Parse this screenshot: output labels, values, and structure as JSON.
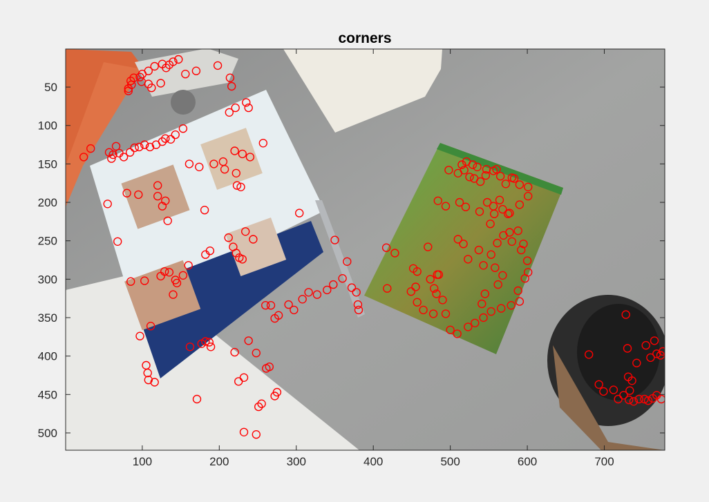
{
  "figure": {
    "background": "#f0f0f0"
  },
  "chart_data": {
    "type": "scatter",
    "title": "corners",
    "xlabel": "",
    "ylabel": "",
    "xlim": [
      0.5,
      778.5
    ],
    "ylim": [
      0.5,
      522.5
    ],
    "y_reversed": true,
    "xticks": [
      100,
      200,
      300,
      400,
      500,
      600,
      700
    ],
    "yticks": [
      50,
      100,
      150,
      200,
      250,
      300,
      350,
      400,
      450,
      500
    ],
    "grid": false,
    "legend": "none",
    "marker": "circle",
    "marker_color": "#ff0000",
    "background_image": "photo of a table with flyer, pen, DVD case, papers and coffee cup",
    "points": [
      [
        147,
        14
      ],
      [
        140,
        17
      ],
      [
        135,
        21
      ],
      [
        126,
        20
      ],
      [
        131,
        25
      ],
      [
        116,
        23
      ],
      [
        108,
        29
      ],
      [
        100,
        33
      ],
      [
        97,
        37
      ],
      [
        89,
        38
      ],
      [
        85,
        42
      ],
      [
        86,
        47
      ],
      [
        99,
        43
      ],
      [
        108,
        46
      ],
      [
        112,
        51
      ],
      [
        124,
        45
      ],
      [
        156,
        33
      ],
      [
        170,
        29
      ],
      [
        198,
        22
      ],
      [
        214,
        38
      ],
      [
        216,
        49
      ],
      [
        221,
        77
      ],
      [
        213,
        83
      ],
      [
        235,
        70
      ],
      [
        238,
        77
      ],
      [
        82,
        52
      ],
      [
        82,
        55
      ],
      [
        57,
        135
      ],
      [
        62,
        138
      ],
      [
        70,
        136
      ],
      [
        76,
        141
      ],
      [
        84,
        135
      ],
      [
        90,
        129
      ],
      [
        96,
        128
      ],
      [
        103,
        125
      ],
      [
        110,
        128
      ],
      [
        118,
        125
      ],
      [
        126,
        121
      ],
      [
        130,
        117
      ],
      [
        137,
        118
      ],
      [
        143,
        112
      ],
      [
        153,
        104
      ],
      [
        66,
        127
      ],
      [
        24,
        141
      ],
      [
        33,
        130
      ],
      [
        60,
        143
      ],
      [
        220,
        133
      ],
      [
        230,
        137
      ],
      [
        240,
        141
      ],
      [
        257,
        123
      ],
      [
        161,
        150
      ],
      [
        174,
        154
      ],
      [
        193,
        150
      ],
      [
        205,
        147
      ],
      [
        207,
        157
      ],
      [
        222,
        162
      ],
      [
        55,
        202
      ],
      [
        80,
        188
      ],
      [
        95,
        190
      ],
      [
        120,
        178
      ],
      [
        120,
        192
      ],
      [
        126,
        205
      ],
      [
        130,
        198
      ],
      [
        133,
        224
      ],
      [
        181,
        210
      ],
      [
        223,
        178
      ],
      [
        228,
        180
      ],
      [
        68,
        251
      ],
      [
        212,
        246
      ],
      [
        234,
        238
      ],
      [
        244,
        248
      ],
      [
        304,
        214
      ],
      [
        350,
        249
      ],
      [
        85,
        303
      ],
      [
        103,
        302
      ],
      [
        124,
        296
      ],
      [
        129,
        290
      ],
      [
        135,
        291
      ],
      [
        143,
        301
      ],
      [
        145,
        305
      ],
      [
        140,
        320
      ],
      [
        153,
        295
      ],
      [
        160,
        282
      ],
      [
        182,
        268
      ],
      [
        188,
        263
      ],
      [
        218,
        258
      ],
      [
        222,
        266
      ],
      [
        226,
        272
      ],
      [
        230,
        274
      ],
      [
        97,
        374
      ],
      [
        111,
        361
      ],
      [
        105,
        412
      ],
      [
        107,
        422
      ],
      [
        108,
        431
      ],
      [
        116,
        434
      ],
      [
        162,
        388
      ],
      [
        177,
        384
      ],
      [
        182,
        381
      ],
      [
        187,
        382
      ],
      [
        189,
        388
      ],
      [
        171,
        456
      ],
      [
        220,
        395
      ],
      [
        225,
        433
      ],
      [
        232,
        428
      ],
      [
        238,
        380
      ],
      [
        248,
        396
      ],
      [
        251,
        466
      ],
      [
        255,
        462
      ],
      [
        261,
        416
      ],
      [
        265,
        414
      ],
      [
        275,
        447
      ],
      [
        272,
        452
      ],
      [
        248,
        502
      ],
      [
        232,
        499
      ],
      [
        260,
        334
      ],
      [
        267,
        334
      ],
      [
        272,
        351
      ],
      [
        277,
        347
      ],
      [
        290,
        333
      ],
      [
        297,
        340
      ],
      [
        308,
        326
      ],
      [
        316,
        317
      ],
      [
        327,
        320
      ],
      [
        340,
        314
      ],
      [
        348,
        307
      ],
      [
        360,
        299
      ],
      [
        366,
        277
      ],
      [
        372,
        311
      ],
      [
        378,
        317
      ],
      [
        380,
        333
      ],
      [
        381,
        340
      ],
      [
        417,
        259
      ],
      [
        428,
        266
      ],
      [
        418,
        312
      ],
      [
        449,
        316
      ],
      [
        457,
        330
      ],
      [
        465,
        340
      ],
      [
        478,
        345
      ],
      [
        479,
        312
      ],
      [
        474,
        300
      ],
      [
        483,
        294
      ],
      [
        471,
        258
      ],
      [
        457,
        290
      ],
      [
        455,
        310
      ],
      [
        485,
        294
      ],
      [
        452,
        286
      ],
      [
        498,
        158
      ],
      [
        510,
        162
      ],
      [
        518,
        158
      ],
      [
        525,
        167
      ],
      [
        531,
        169
      ],
      [
        539,
        173
      ],
      [
        546,
        165
      ],
      [
        556,
        159
      ],
      [
        572,
        176
      ],
      [
        583,
        169
      ],
      [
        590,
        177
      ],
      [
        601,
        180
      ],
      [
        484,
        198
      ],
      [
        494,
        205
      ],
      [
        512,
        200
      ],
      [
        520,
        206
      ],
      [
        538,
        212
      ],
      [
        548,
        200
      ],
      [
        556,
        205
      ],
      [
        568,
        209
      ],
      [
        577,
        214
      ],
      [
        590,
        203
      ],
      [
        601,
        192
      ],
      [
        577,
        239
      ],
      [
        588,
        237
      ],
      [
        595,
        254
      ],
      [
        510,
        248
      ],
      [
        517,
        254
      ],
      [
        523,
        274
      ],
      [
        537,
        262
      ],
      [
        543,
        282
      ],
      [
        553,
        268
      ],
      [
        561,
        253
      ],
      [
        569,
        243
      ],
      [
        580,
        251
      ],
      [
        592,
        262
      ],
      [
        600,
        276
      ],
      [
        601,
        291
      ],
      [
        597,
        299
      ],
      [
        588,
        315
      ],
      [
        590,
        329
      ],
      [
        579,
        334
      ],
      [
        566,
        338
      ],
      [
        553,
        342
      ],
      [
        543,
        350
      ],
      [
        532,
        357
      ],
      [
        523,
        362
      ],
      [
        509,
        371
      ],
      [
        500,
        366
      ],
      [
        494,
        345
      ],
      [
        490,
        327
      ],
      [
        482,
        319
      ],
      [
        515,
        151
      ],
      [
        521,
        147
      ],
      [
        529,
        151
      ],
      [
        535,
        154
      ],
      [
        547,
        157
      ],
      [
        560,
        157
      ],
      [
        565,
        166
      ],
      [
        580,
        168
      ],
      [
        557,
        215
      ],
      [
        552,
        228
      ],
      [
        575,
        215
      ],
      [
        564,
        197
      ],
      [
        558,
        285
      ],
      [
        568,
        295
      ],
      [
        562,
        307
      ],
      [
        545,
        319
      ],
      [
        541,
        332
      ],
      [
        680,
        398
      ],
      [
        693,
        437
      ],
      [
        699,
        446
      ],
      [
        712,
        444
      ],
      [
        718,
        456
      ],
      [
        725,
        451
      ],
      [
        732,
        457
      ],
      [
        738,
        459
      ],
      [
        745,
        456
      ],
      [
        752,
        456
      ],
      [
        757,
        458
      ],
      [
        763,
        455
      ],
      [
        768,
        451
      ],
      [
        774,
        456
      ],
      [
        731,
        427
      ],
      [
        736,
        432
      ],
      [
        733,
        445
      ],
      [
        742,
        409
      ],
      [
        730,
        390
      ],
      [
        728,
        346
      ],
      [
        760,
        402
      ],
      [
        768,
        397
      ],
      [
        773,
        399
      ],
      [
        776,
        394
      ],
      [
        765,
        380
      ],
      [
        754,
        386
      ]
    ]
  }
}
